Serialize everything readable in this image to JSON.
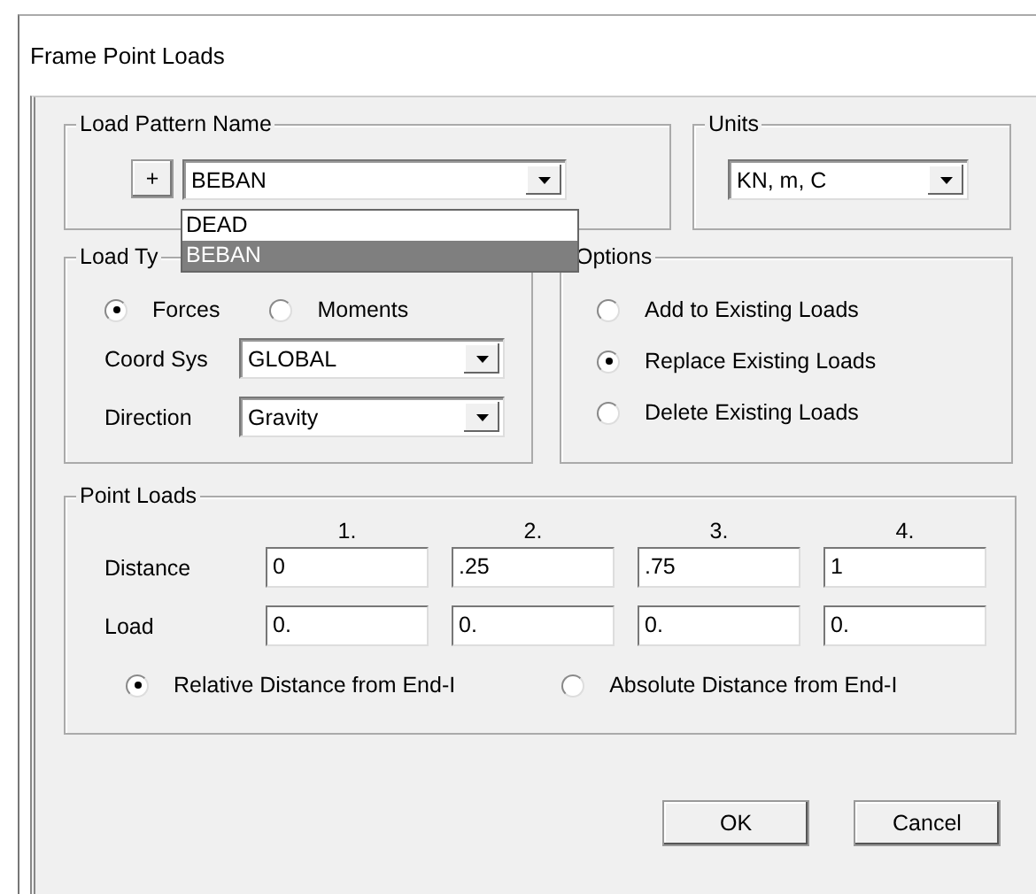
{
  "window": {
    "title": "Frame Point Loads"
  },
  "load_pattern": {
    "label": "Load Pattern Name",
    "add_button": "+",
    "value": "BEBAN",
    "dropdown": [
      {
        "label": "DEAD",
        "selected": false
      },
      {
        "label": "BEBAN",
        "selected": true
      }
    ]
  },
  "units": {
    "label": "Units",
    "value": "KN, m, C"
  },
  "load_type": {
    "label": "Load Ty",
    "types": [
      {
        "label": "Forces",
        "selected": true
      },
      {
        "label": "Moments",
        "selected": false
      }
    ],
    "coord_sys": {
      "label": "Coord Sys",
      "value": "GLOBAL"
    },
    "direction": {
      "label": "Direction",
      "value": "Gravity"
    }
  },
  "options": {
    "label": "Options",
    "items": [
      {
        "label": "Add to Existing Loads",
        "selected": false
      },
      {
        "label": "Replace Existing Loads",
        "selected": true
      },
      {
        "label": "Delete Existing Loads",
        "selected": false
      }
    ]
  },
  "point_loads": {
    "label": "Point Loads",
    "columns": [
      "1.",
      "2.",
      "3.",
      "4."
    ],
    "rows": [
      {
        "label": "Distance",
        "values": [
          "0",
          ".25",
          ".75",
          "1"
        ]
      },
      {
        "label": "Load",
        "values": [
          "0.",
          "0.",
          "0.",
          "0."
        ]
      }
    ],
    "distance_modes": [
      {
        "label": "Relative Distance from End-I",
        "selected": true
      },
      {
        "label": "Absolute Distance from End-I",
        "selected": false
      }
    ]
  },
  "buttons": [
    "OK",
    "Cancel"
  ]
}
